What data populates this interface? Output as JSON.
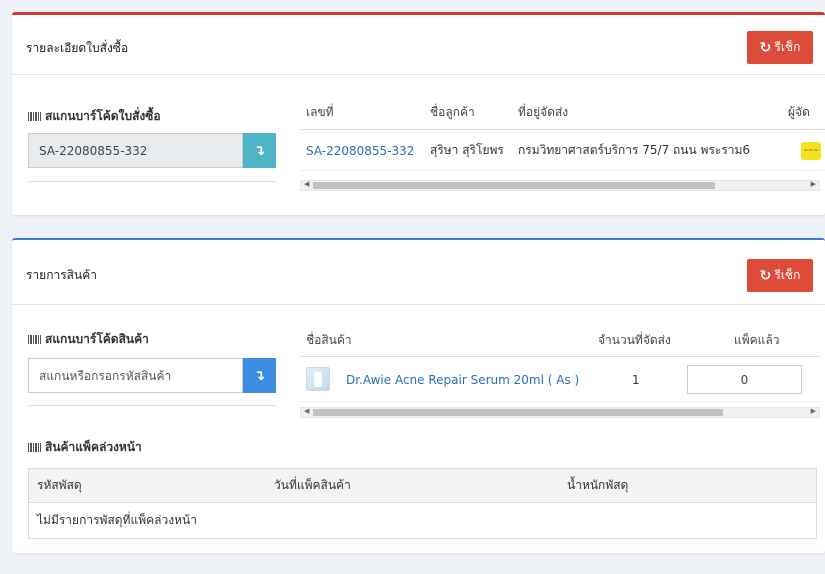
{
  "order_card": {
    "title": "รายละเอียดใบสั่งซื้อ",
    "refresh_label": "รีเช็ก",
    "scan_label": "สแกนบาร์โค้ดใบสั่งซื้อ",
    "scan_value": "SA-22080855-332",
    "table": {
      "headers": [
        "เลขที่",
        "ชื่อลูกค้า",
        "ที่อยู่จัดส่ง",
        "ผู้จัด"
      ],
      "row": {
        "order_no": "SA-22080855-332",
        "customer": "สุริษา สุริโยพร",
        "address": "กรมวิทยาศาสตร์บริการ 75/7 ถนน พระราม6"
      }
    }
  },
  "product_card": {
    "title": "รายการสินค้า",
    "refresh_label": "รีเช็ก",
    "scan_label": "สแกนบาร์โค้ดสินค้า",
    "scan_placeholder": "สแกนหรือกรอกรหัสสินค้า",
    "table": {
      "headers": [
        "ชื่อสินค้า",
        "จำนวนที่จัดส่ง",
        "แพ็คแล้ว"
      ],
      "row": {
        "name": "Dr.Awie Acne Repair Serum 20ml ( As )",
        "qty": "1",
        "packed": "0"
      }
    },
    "prepack": {
      "label": "สินค้าแพ็คล่วงหน้า",
      "headers": [
        "รหัสพัสดุ",
        "วันที่แพ็คสินค้า",
        "น้ำหนักพัสดุ"
      ],
      "empty_text": "ไม่มีรายการพัสดุที่แพ็คล่วงหน้า"
    }
  },
  "colors": {
    "danger": "#dd4b39",
    "primary": "#3c8ce0",
    "info": "#4fb5c8"
  }
}
